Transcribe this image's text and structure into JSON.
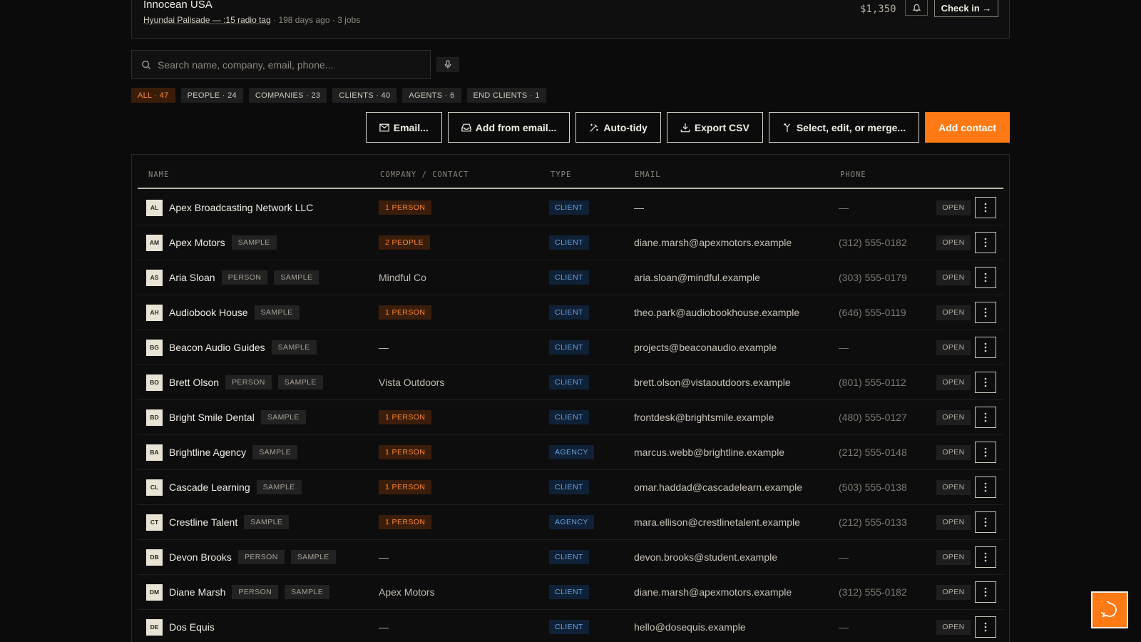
{
  "top_item": {
    "title": "Innocean USA",
    "link_text": "Hyundai Palisade — :15 radio tag",
    "meta": " · 198 days ago · 3 jobs",
    "amount": "$1,350",
    "checkin_label": "Check in →"
  },
  "search": {
    "placeholder": "Search name, company, email, phone..."
  },
  "filters": [
    {
      "label": "ALL · 47",
      "active": true
    },
    {
      "label": "PEOPLE · 24",
      "active": false
    },
    {
      "label": "COMPANIES · 23",
      "active": false
    },
    {
      "label": "CLIENTS · 40",
      "active": false
    },
    {
      "label": "AGENTS · 6",
      "active": false
    },
    {
      "label": "END CLIENTS · 1",
      "active": false
    }
  ],
  "toolbar": {
    "email": "Email...",
    "add_from_email": "Add from email...",
    "auto_tidy": "Auto-tidy",
    "export_csv": "Export CSV",
    "select_edit_merge": "Select, edit, or merge...",
    "add_contact": "Add contact"
  },
  "table": {
    "headers": {
      "name": "NAME",
      "company": "COMPANY / CONTACT",
      "type": "TYPE",
      "email": "EMAIL",
      "phone": "PHONE"
    },
    "open_label": "OPEN",
    "rows": [
      {
        "initials": "AL",
        "name": "Apex Broadcasting Network LLC",
        "tags": [],
        "company": "1 PERSON",
        "company_kind": "count",
        "type": "CLIENT",
        "email": "—",
        "phone": "—"
      },
      {
        "initials": "AM",
        "name": "Apex Motors",
        "tags": [
          "SAMPLE"
        ],
        "company": "2 PEOPLE",
        "company_kind": "count",
        "type": "CLIENT",
        "email": "diane.marsh@apexmotors.example",
        "phone": "(312) 555-0182"
      },
      {
        "initials": "AS",
        "name": "Aria Sloan",
        "tags": [
          "PERSON",
          "SAMPLE"
        ],
        "company": "Mindful Co",
        "company_kind": "text",
        "type": "CLIENT",
        "email": "aria.sloan@mindful.example",
        "phone": "(303) 555-0179"
      },
      {
        "initials": "AH",
        "name": "Audiobook House",
        "tags": [
          "SAMPLE"
        ],
        "company": "1 PERSON",
        "company_kind": "count",
        "type": "CLIENT",
        "email": "theo.park@audiobookhouse.example",
        "phone": "(646) 555-0119"
      },
      {
        "initials": "BG",
        "name": "Beacon Audio Guides",
        "tags": [
          "SAMPLE"
        ],
        "company": "—",
        "company_kind": "text",
        "type": "CLIENT",
        "email": "projects@beaconaudio.example",
        "phone": "—"
      },
      {
        "initials": "BO",
        "name": "Brett Olson",
        "tags": [
          "PERSON",
          "SAMPLE"
        ],
        "company": "Vista Outdoors",
        "company_kind": "text",
        "type": "CLIENT",
        "email": "brett.olson@vistaoutdoors.example",
        "phone": "(801) 555-0112"
      },
      {
        "initials": "BD",
        "name": "Bright Smile Dental",
        "tags": [
          "SAMPLE"
        ],
        "company": "1 PERSON",
        "company_kind": "count",
        "type": "CLIENT",
        "email": "frontdesk@brightsmile.example",
        "phone": "(480) 555-0127"
      },
      {
        "initials": "BA",
        "name": "Brightline Agency",
        "tags": [
          "SAMPLE"
        ],
        "company": "1 PERSON",
        "company_kind": "count",
        "type": "AGENCY",
        "email": "marcus.webb@brightline.example",
        "phone": "(212) 555-0148"
      },
      {
        "initials": "CL",
        "name": "Cascade Learning",
        "tags": [
          "SAMPLE"
        ],
        "company": "1 PERSON",
        "company_kind": "count",
        "type": "CLIENT",
        "email": "omar.haddad@cascadelearn.example",
        "phone": "(503) 555-0138"
      },
      {
        "initials": "CT",
        "name": "Crestline Talent",
        "tags": [
          "SAMPLE"
        ],
        "company": "1 PERSON",
        "company_kind": "count",
        "type": "AGENCY",
        "email": "mara.ellison@crestlinetalent.example",
        "phone": "(212) 555-0133"
      },
      {
        "initials": "DB",
        "name": "Devon Brooks",
        "tags": [
          "PERSON",
          "SAMPLE"
        ],
        "company": "—",
        "company_kind": "text",
        "type": "CLIENT",
        "email": "devon.brooks@student.example",
        "phone": "—"
      },
      {
        "initials": "DM",
        "name": "Diane Marsh",
        "tags": [
          "PERSON",
          "SAMPLE"
        ],
        "company": "Apex Motors",
        "company_kind": "text",
        "type": "CLIENT",
        "email": "diane.marsh@apexmotors.example",
        "phone": "(312) 555-0182"
      },
      {
        "initials": "DE",
        "name": "Dos Equis",
        "tags": [],
        "company": "—",
        "company_kind": "text",
        "type": "CLIENT",
        "email": "hello@dosequis.example",
        "phone": "—"
      }
    ]
  },
  "colors": {
    "accent": "#ff7a14",
    "background": "#0b0b0b",
    "client_badge": "#6ea2de",
    "count_badge": "#ff8a33"
  },
  "icons": [
    "search-icon",
    "mic-icon",
    "bell-icon",
    "mail-icon",
    "inbox-icon",
    "wand-icon",
    "download-icon",
    "merge-icon",
    "kebab-icon",
    "chat-icon"
  ]
}
